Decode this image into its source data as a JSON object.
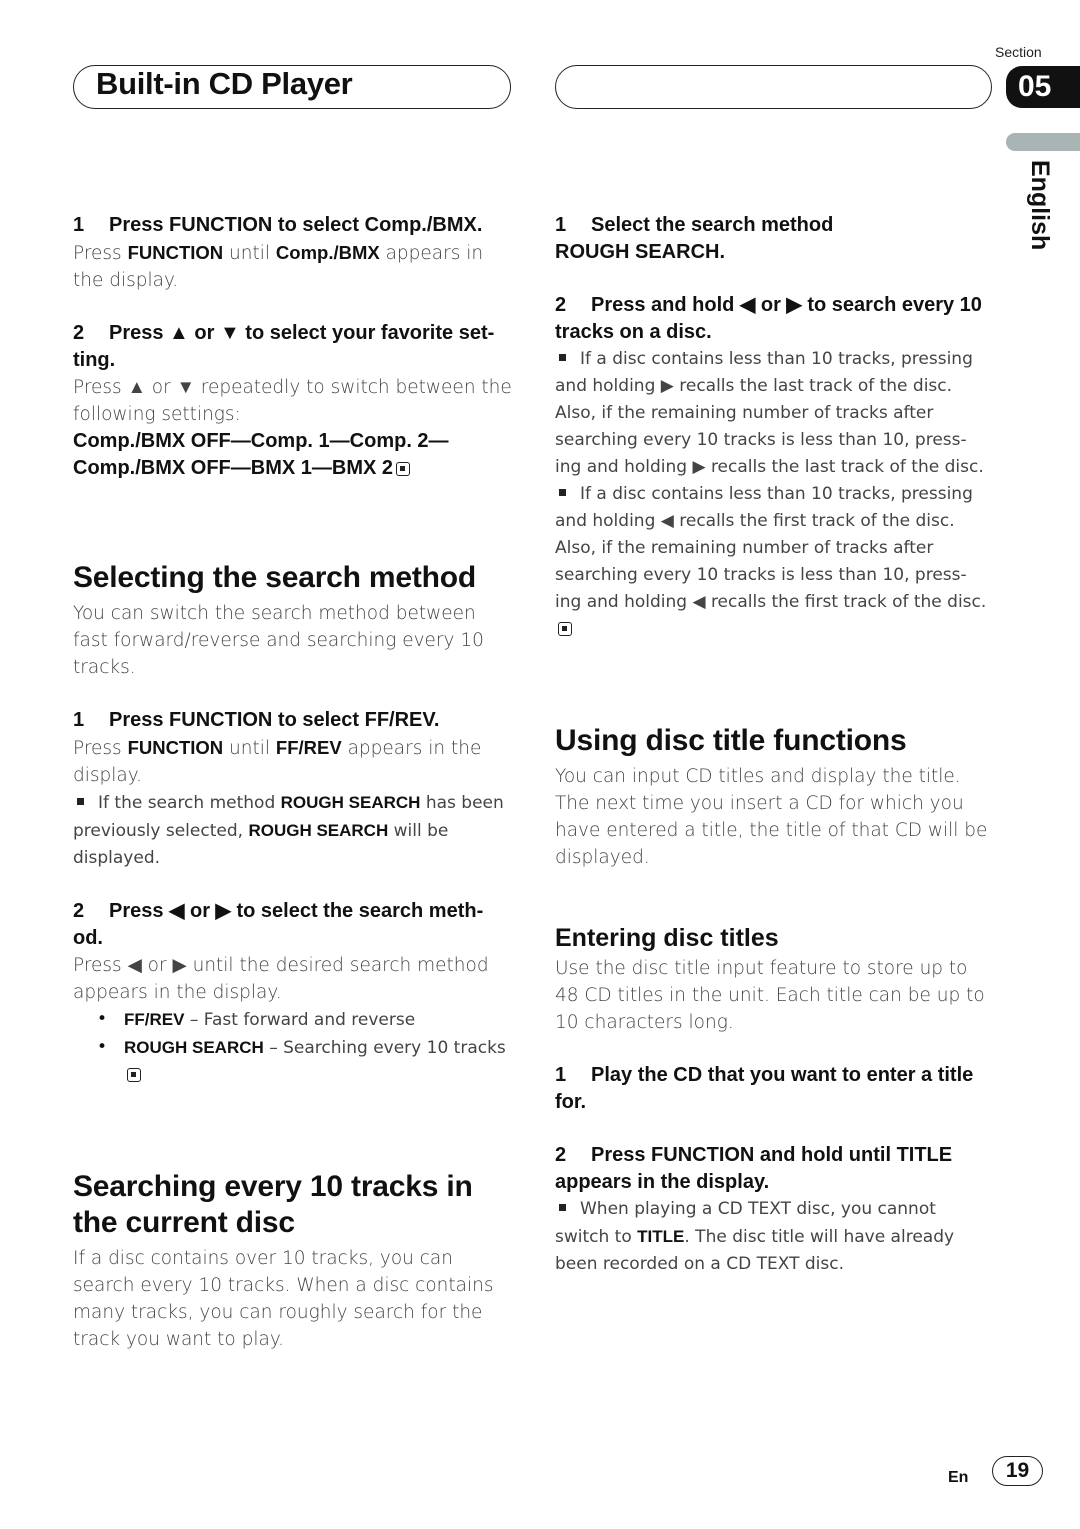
{
  "header": {
    "chapter_title": "Built-in CD Player",
    "section_label": "Section",
    "section_number": "05",
    "language_tab": "English"
  },
  "left_column": {
    "step1_num": "1",
    "step1_title": "Press FUNCTION to select Comp./BMX.",
    "step1_body_pre": "Press ",
    "step1_body_b1": "FUNCTION",
    "step1_body_mid": " until ",
    "step1_body_b2": "Comp./BMX",
    "step1_body_post": " appears in the display.",
    "step2_num": "2",
    "step2_title": "Press ▲ or ▼ to select your favorite set-ting.",
    "step2_body": "Press ▲ or ▼ repeatedly to switch between the following settings:",
    "settings_line1": "Comp./BMX OFF—Comp. 1—Comp. 2—",
    "settings_line2": "Comp./BMX OFF—BMX 1—BMX 2",
    "section_search_method": {
      "heading": "Selecting the search method",
      "intro": "You can switch the search method between fast forward/reverse and searching every 10 tracks.",
      "step1_num": "1",
      "step1_title": "Press FUNCTION to select FF/REV.",
      "step1_body_pre": "Press ",
      "step1_body_b1": "FUNCTION",
      "step1_body_mid": " until ",
      "step1_body_b2": "FF/REV",
      "step1_body_post": " appears in the display.",
      "note_pre": "If the search method ",
      "note_b1": "ROUGH SEARCH",
      "note_mid": " has been previously selected, ",
      "note_b2": "ROUGH SEARCH",
      "note_post": " will be displayed.",
      "step2_num": "2",
      "step2_title": "Press ◀ or ▶ to select the search meth-od.",
      "step2_body": "Press ◀ or ▶ until the desired search method appears in the display.",
      "bullets": [
        {
          "term": "FF/REV",
          "desc": " – Fast forward and reverse"
        },
        {
          "term": "ROUGH SEARCH",
          "desc": " – Searching every 10 tracks"
        }
      ]
    },
    "section_every10": {
      "heading": "Searching every 10 tracks in the current disc",
      "intro": "If a disc contains over 10 tracks, you can search every 10 tracks. When a disc contains many tracks, you can roughly search for the track you want to play."
    }
  },
  "right_column": {
    "step1_num": "1",
    "step1_title": "Select the search method",
    "step1_value": "ROUGH SEARCH.",
    "step2_num": "2",
    "step2_title": "Press and hold ◀ or ▶ to search every 10 tracks on a disc.",
    "notes": [
      "If a disc contains less than 10 tracks, pressing and holding ▶ recalls the last track of the disc. Also, if the remaining number of tracks after searching every 10 tracks is less than 10, press-ing and holding ▶ recalls the last track of the disc.",
      "If a disc contains less than 10 tracks, pressing and holding ◀ recalls the first track of the disc. Also, if the remaining number of tracks after searching every 10 tracks is less than 10, press-ing and holding ◀ recalls the first track of the disc."
    ],
    "section_title_functions": {
      "heading": "Using disc title functions",
      "intro": "You can input CD titles and display the title. The next time you insert a CD for which you have entered a title, the title of that CD will be displayed."
    },
    "section_entering": {
      "heading": "Entering disc titles",
      "intro": "Use the disc title input feature to store up to 48 CD titles in the unit. Each title can be up to 10 characters long.",
      "step1_num": "1",
      "step1_title": "Play the CD that you want to enter a title for.",
      "step2_num": "2",
      "step2_title": "Press FUNCTION and hold until TITLE appears in the display.",
      "note_pre": "When playing a CD TEXT disc, you cannot switch to ",
      "note_b1": "TITLE",
      "note_post": ". The disc title will have already been recorded on a CD TEXT disc."
    }
  },
  "footer": {
    "lang_code": "En",
    "page_number": "19"
  }
}
